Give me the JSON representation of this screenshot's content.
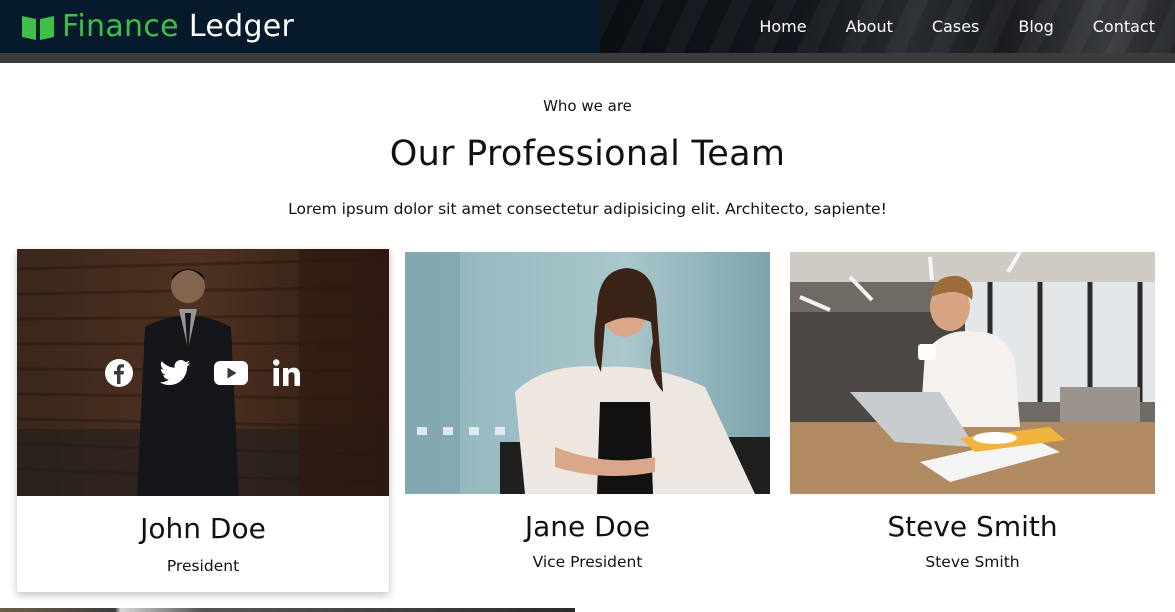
{
  "brand": {
    "part1": "Finance",
    "part2": "Ledger",
    "icon": "book-icon"
  },
  "nav": {
    "items": [
      "Home",
      "About",
      "Cases",
      "Blog",
      "Contact"
    ]
  },
  "intro": {
    "eyebrow": "Who we are",
    "title": "Our Professional Team",
    "lead": "Lorem ipsum dolor sit amet consectetur adipisicing elit. Architecto, sapiente!"
  },
  "team": [
    {
      "name": "John Doe",
      "role": "President"
    },
    {
      "name": "Jane Doe",
      "role": "Vice President"
    },
    {
      "name": "Steve Smith",
      "role": "Steve Smith"
    }
  ],
  "social": [
    "facebook-icon",
    "twitter-icon",
    "youtube-icon",
    "linkedin-icon"
  ],
  "colors": {
    "brand_green": "#3fbf4a",
    "header_bg": "#061a2b"
  }
}
